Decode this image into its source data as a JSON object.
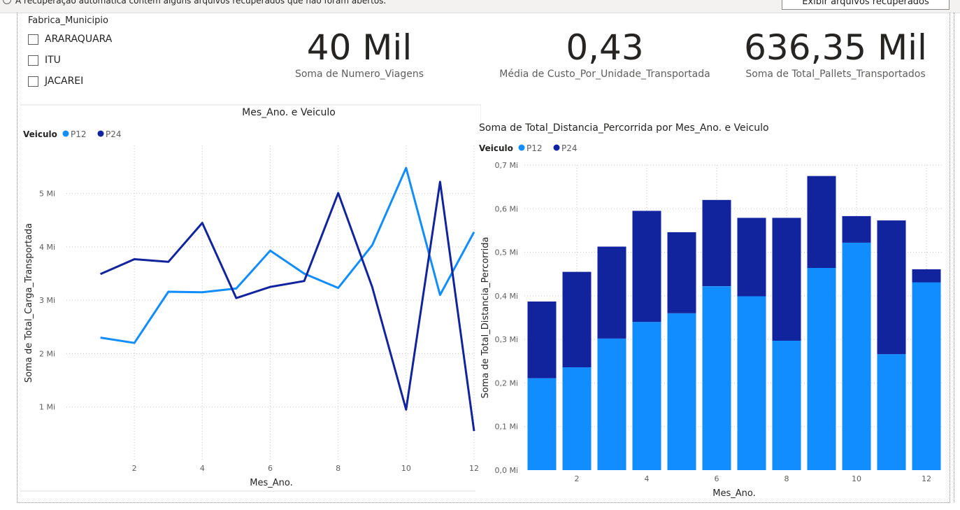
{
  "notification": {
    "message": "A recuperação automática contém alguns arquivos recuperados que não foram abertos.",
    "button_label": "Exibir arquivos recuperados"
  },
  "slicer": {
    "title": "Fabrica_Municipio",
    "items": [
      {
        "label": "ARARAQUARA",
        "checked": false
      },
      {
        "label": "ITU",
        "checked": false
      },
      {
        "label": "JACAREI",
        "checked": false
      }
    ]
  },
  "cards": [
    {
      "value": "40 Mil",
      "label": "Soma de Numero_Viagens"
    },
    {
      "value": "0,43",
      "label": "Média de Custo_Por_Unidade_Transportada"
    },
    {
      "value": "636,35 Mil",
      "label": "Soma de Total_Pallets_Transportados"
    }
  ],
  "colors": {
    "p12": "#118dff",
    "p24": "#12239e",
    "axis_text": "#605e5c",
    "grid": "#c8c6c4"
  },
  "chart_data": [
    {
      "type": "line",
      "title": "Mes_Ano. e Veiculo",
      "legend_title": "Veiculo",
      "legend_position": "top-left",
      "xlabel": "Mes_Ano.",
      "ylabel": "Soma de Total_Carga_Transportada",
      "x": [
        1,
        2,
        3,
        4,
        5,
        6,
        7,
        8,
        9,
        10,
        11,
        12
      ],
      "x_ticks": [
        2,
        4,
        6,
        8,
        10,
        12
      ],
      "y_ticks": [
        {
          "v": 1,
          "label": "1 Mi"
        },
        {
          "v": 2,
          "label": "2 Mi"
        },
        {
          "v": 3,
          "label": "3 Mi"
        },
        {
          "v": 4,
          "label": "4 Mi"
        },
        {
          "v": 5,
          "label": "5 Mi"
        }
      ],
      "ylim": [
        0,
        5.9
      ],
      "xlim": [
        0,
        12
      ],
      "grid": true,
      "series": [
        {
          "name": "P12",
          "values": [
            2.3,
            2.2,
            3.16,
            3.15,
            3.22,
            3.93,
            3.5,
            3.23,
            4.03,
            5.48,
            3.1,
            4.28
          ]
        },
        {
          "name": "P24",
          "values": [
            3.49,
            3.77,
            3.72,
            4.45,
            3.04,
            3.25,
            3.36,
            5.01,
            3.25,
            0.95,
            5.22,
            0.55
          ]
        }
      ]
    },
    {
      "type": "bar",
      "stacked": true,
      "title": "Soma de Total_Distancia_Percorrida por Mes_Ano. e Veiculo",
      "legend_title": "Veiculo",
      "legend_position": "top-left",
      "xlabel": "Mes_Ano.",
      "ylabel": "Soma de Total_Distancia_Percorrida",
      "categories": [
        1,
        2,
        3,
        4,
        5,
        6,
        7,
        8,
        9,
        10,
        11,
        12
      ],
      "x_ticks": [
        2,
        4,
        6,
        8,
        10,
        12
      ],
      "y_ticks": [
        {
          "v": 0,
          "label": "0,0 Mi"
        },
        {
          "v": 0.1,
          "label": "0,1 Mi"
        },
        {
          "v": 0.2,
          "label": "0,2 Mi"
        },
        {
          "v": 0.3,
          "label": "0,3 Mi"
        },
        {
          "v": 0.4,
          "label": "0,4 Mi"
        },
        {
          "v": 0.5,
          "label": "0,5 Mi"
        },
        {
          "v": 0.6,
          "label": "0,6 Mi"
        },
        {
          "v": 0.7,
          "label": "0,7 Mi"
        }
      ],
      "ylim": [
        0,
        0.7
      ],
      "grid": true,
      "series": [
        {
          "name": "P12",
          "values": [
            0.211,
            0.236,
            0.302,
            0.34,
            0.36,
            0.422,
            0.399,
            0.297,
            0.464,
            0.522,
            0.266,
            0.431
          ]
        },
        {
          "name": "P24",
          "values": [
            0.176,
            0.219,
            0.211,
            0.255,
            0.186,
            0.198,
            0.18,
            0.282,
            0.211,
            0.061,
            0.307,
            0.03
          ]
        }
      ]
    }
  ]
}
